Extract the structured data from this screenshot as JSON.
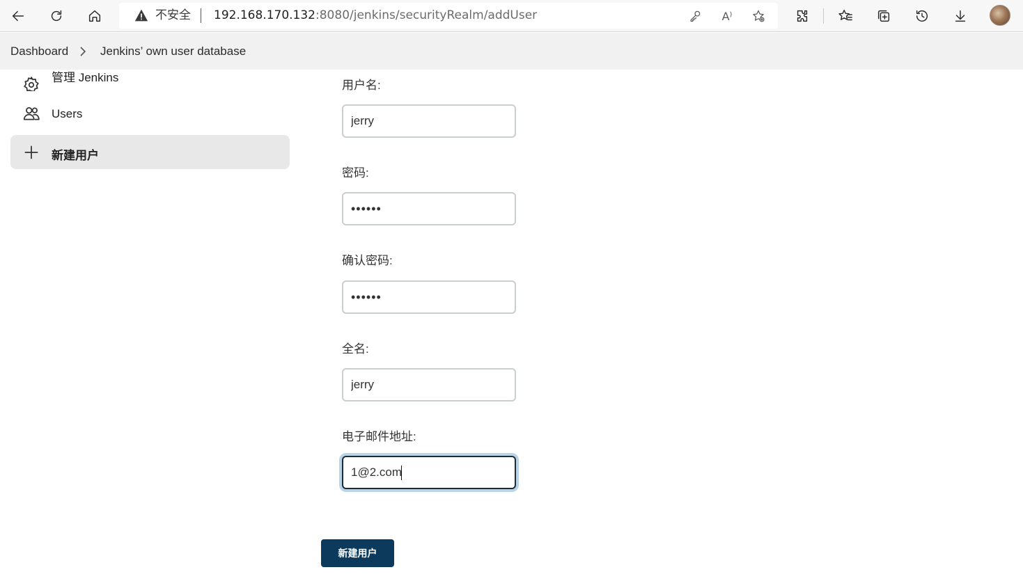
{
  "browser": {
    "security_label": "不安全",
    "url_host": "192.168.170.132",
    "url_rest": ":8080/jenkins/securityRealm/addUser",
    "icons": [
      "back-icon",
      "refresh-icon",
      "home-icon",
      "warning-icon",
      "key-icon",
      "read-aloud-icon",
      "add-favorite-icon",
      "extensions-icon",
      "favorites-icon",
      "collections-icon",
      "history-icon",
      "downloads-icon"
    ],
    "read_aloud_glyph": "A⁾"
  },
  "breadcrumb": {
    "items": [
      "Dashboard",
      "Jenkins’ own user database"
    ]
  },
  "sidebar": {
    "items": [
      {
        "label": "管理 Jenkins",
        "icon": "gear-icon"
      },
      {
        "label": "Users",
        "icon": "users-icon"
      },
      {
        "label": "新建用户",
        "icon": "plus-icon",
        "active": true
      }
    ]
  },
  "form": {
    "username": {
      "label": "用户名:",
      "value": "jerry"
    },
    "password": {
      "label": "密码:",
      "value": "••••••"
    },
    "confirm_password": {
      "label": "确认密码:",
      "value": "••••••"
    },
    "fullname": {
      "label": "全名:",
      "value": "jerry"
    },
    "email": {
      "label": "电子邮件地址:",
      "value": "1@2.com"
    },
    "submit_label": "新建用户"
  },
  "colors": {
    "primary_button": "#0b3a5c",
    "focus_ring": "#b8d4e6",
    "sidebar_active": "#e8e8e8"
  }
}
